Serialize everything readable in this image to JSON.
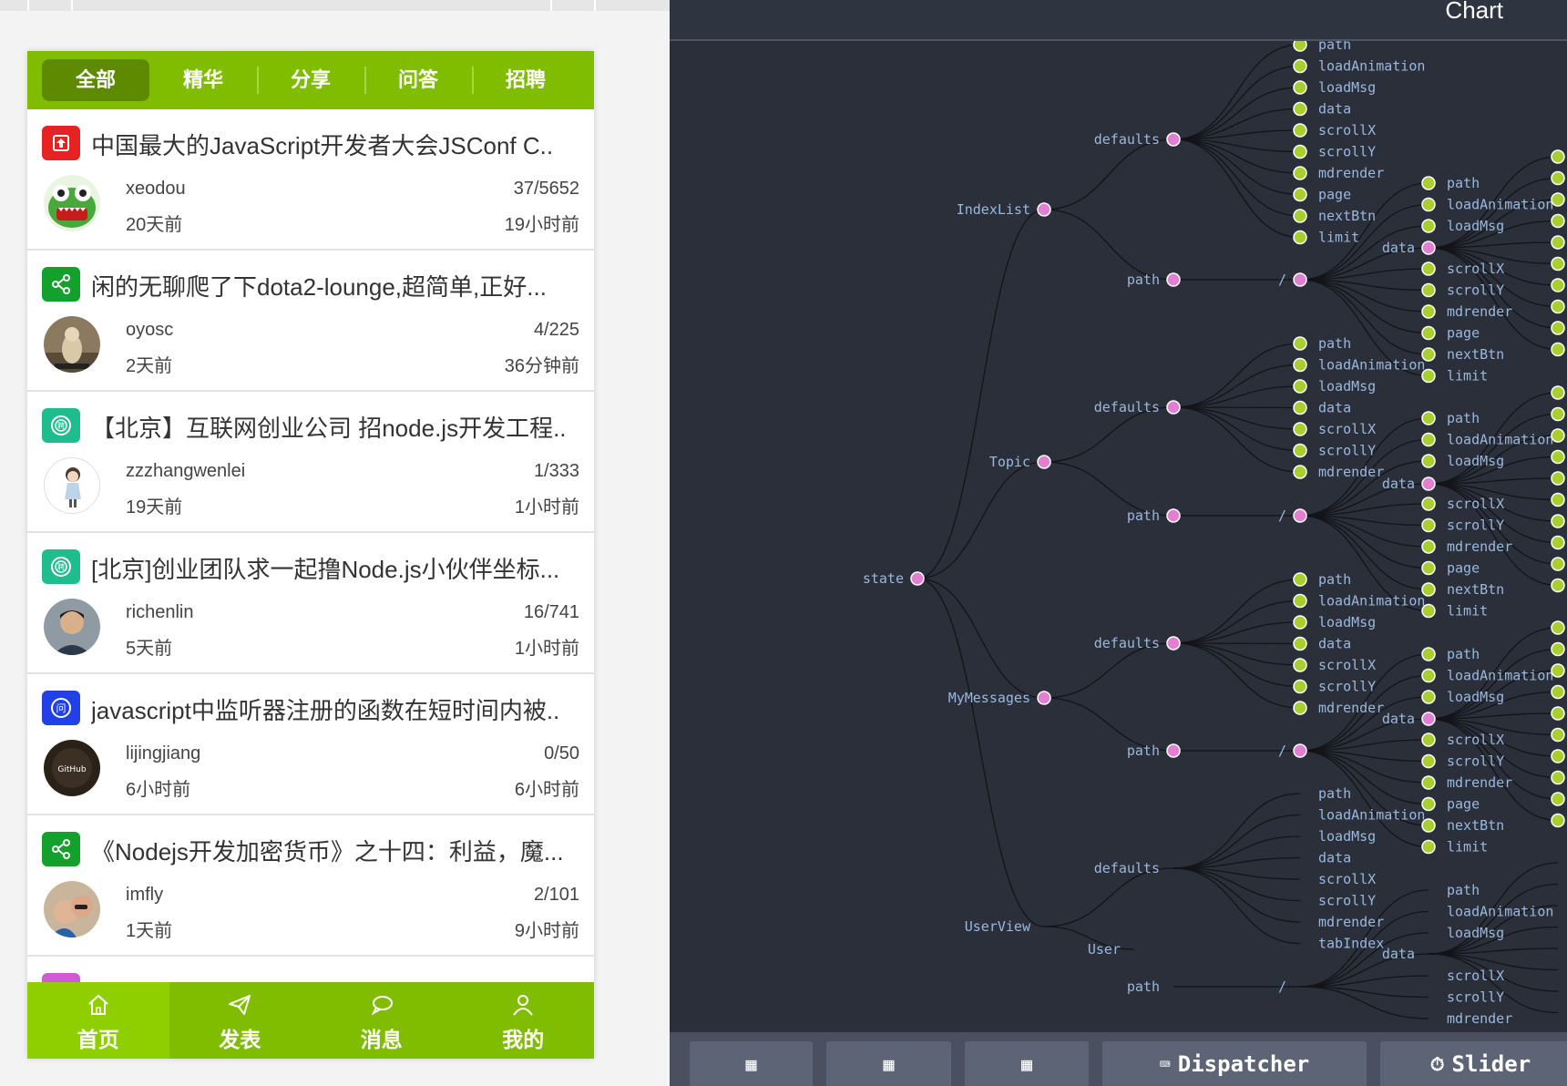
{
  "tabs": [
    {
      "label": "全部",
      "active": true
    },
    {
      "label": "精华"
    },
    {
      "label": "分享"
    },
    {
      "label": "问答"
    },
    {
      "label": "招聘"
    }
  ],
  "topics": [
    {
      "icon": "top-pin-icon",
      "badge_color": "#e62222",
      "title": "中国最大的JavaScript开发者大会JSConf C..",
      "author": "xeodou",
      "created": "20天前",
      "counts": "37/5652",
      "updated": "19小时前",
      "avatar": "frog"
    },
    {
      "icon": "share-icon",
      "badge_color": "#13a02c",
      "title": "闲的无聊爬了下dota2-lounge,超简单,正好...",
      "author": "oyosc",
      "created": "2天前",
      "counts": "4/225",
      "updated": "36分钟前",
      "avatar": "dog"
    },
    {
      "icon": "job-icon",
      "badge_color": "#1fbd8d",
      "title": "【北京】互联网创业公司 招node.js开发工程..",
      "author": "zzzhangwenlei",
      "created": "19天前",
      "counts": "1/333",
      "updated": "1小时前",
      "avatar": "girl"
    },
    {
      "icon": "job-icon",
      "badge_color": "#1fbd8d",
      "title": "[北京]创业团队求一起撸Node.js小伙伴坐标...",
      "author": "richenlin",
      "created": "5天前",
      "counts": "16/741",
      "updated": "1小时前",
      "avatar": "man"
    },
    {
      "icon": "question-icon",
      "badge_color": "#2140e6",
      "title": "javascript中监听器注册的函数在短时间内被..",
      "author": "lijingjiang",
      "created": "6小时前",
      "counts": "0/50",
      "updated": "6小时前",
      "avatar": "github"
    },
    {
      "icon": "share-icon",
      "badge_color": "#13a02c",
      "title": "《Nodejs开发加密货币》之十四：利益，魔...",
      "author": "imfly",
      "created": "1天前",
      "counts": "2/101",
      "updated": "9小时前",
      "avatar": "family"
    }
  ],
  "bottom_nav": [
    {
      "label": "首页",
      "icon": "home-icon",
      "active": true
    },
    {
      "label": "发表",
      "icon": "send-icon"
    },
    {
      "label": "消息",
      "icon": "message-icon"
    },
    {
      "label": "我的",
      "icon": "user-icon"
    }
  ],
  "devtools": {
    "chart_label": "Chart",
    "tree": {
      "root": "state",
      "state_children": [
        "IndexList",
        "Topic",
        "MyMessages",
        "UserView"
      ],
      "defaults_label": "defaults",
      "path_label": "path",
      "slash_label": "/",
      "data_label": "data",
      "user_label": "User",
      "defaults_fields": [
        "path",
        "loadAnimation",
        "loadMsg",
        "data",
        "scrollX",
        "scrollY",
        "mdrender",
        "page",
        "nextBtn",
        "limit"
      ],
      "topic_defaults_fields": [
        "path",
        "loadAnimation",
        "loadMsg",
        "data",
        "scrollX",
        "scrollY",
        "mdrender"
      ],
      "mymessages_defaults_fields": [
        "path",
        "loadAnimation",
        "loadMsg",
        "data",
        "scrollX",
        "scrollY",
        "mdrender"
      ],
      "userview_defaults_fields": [
        "path",
        "loadAnimation",
        "loadMsg",
        "data",
        "scrollX",
        "scrollY",
        "mdrender",
        "tabIndex"
      ],
      "path_fields_top": [
        "path",
        "loadAnimation",
        "loadMsg"
      ],
      "path_fields_bottom": [
        "scrollX",
        "scrollY",
        "mdrender",
        "page",
        "nextBtn",
        "limit"
      ],
      "userview_path_fields_bottom": [
        "scrollX",
        "scrollY",
        "mdrender"
      ],
      "colors": {
        "inner_node": "#e37fd3",
        "leaf_node": "#a8cf2f",
        "label": "#9ab8de",
        "link": "#121418"
      }
    },
    "footer_buttons": [
      {
        "icon": "grid-icon",
        "label": ""
      },
      {
        "icon": "grid-icon",
        "label": ""
      },
      {
        "icon": "grid-icon",
        "label": ""
      },
      {
        "icon": "keyboard-icon",
        "label": "Dispatcher"
      },
      {
        "icon": "stopwatch-icon",
        "label": "Slider"
      }
    ]
  }
}
